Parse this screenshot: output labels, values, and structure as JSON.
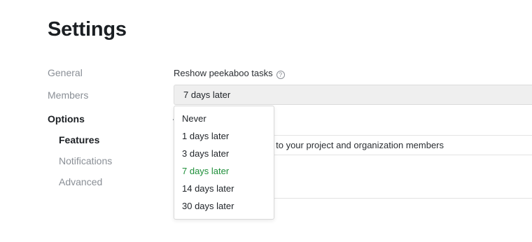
{
  "page": {
    "title": "Settings"
  },
  "sidebar": {
    "items": [
      {
        "label": "General"
      },
      {
        "label": "Members"
      },
      {
        "label": "Options"
      },
      {
        "label": "Features"
      },
      {
        "label": "Notifications"
      },
      {
        "label": "Advanced"
      }
    ]
  },
  "reshow": {
    "label": "Reshow peekaboo tasks",
    "help_icon": "?",
    "value": "7 days later",
    "options": [
      {
        "label": "Never"
      },
      {
        "label": "1 days later"
      },
      {
        "label": "3 days later"
      },
      {
        "label": "7 days later"
      },
      {
        "label": "14 days later"
      },
      {
        "label": "30 days later"
      }
    ],
    "selected_index": 3,
    "selected_color": "#1f8f3a"
  },
  "visibility_row": {
    "text": "y to your project and organization members"
  }
}
